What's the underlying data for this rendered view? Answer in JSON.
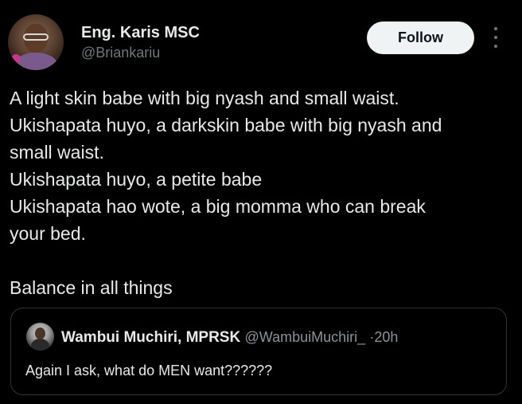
{
  "author": {
    "name": "Eng. Karis MSC",
    "handle": "@Briankariu"
  },
  "follow_button": {
    "label": "Follow"
  },
  "more_menu": {
    "icon": "more-vertical-icon"
  },
  "tweet": {
    "lines": [
      "A light skin babe with big nyash and small waist.",
      "Ukishapata huyo, a darkskin babe with big nyash and",
      "small waist.",
      "Ukishapata huyo, a petite babe",
      "Ukishapata hao wote, a big momma who can break",
      "your bed.",
      "",
      "Balance in all things"
    ]
  },
  "quoted_tweet": {
    "name": "Wambui Muchiri, MPRSK",
    "handle": "@WambuiMuchiri_",
    "separator": "·",
    "time": "20h",
    "text": "Again I ask, what do MEN want??????"
  },
  "colors": {
    "background": "#000000",
    "text": "#e7e9ea",
    "secondary_text": "#71767b",
    "follow_button_bg": "#eff3f4",
    "border": "#2f3336"
  }
}
